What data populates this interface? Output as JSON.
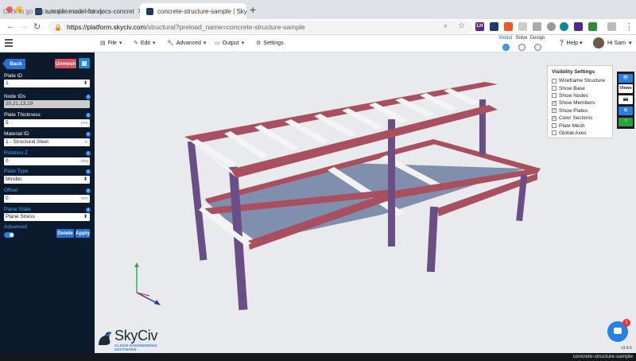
{
  "browser": {
    "hover_tip": "Click to go back, hold to see history",
    "tabs": [
      {
        "title": "sample-model-for-docs-concret",
        "active": false
      },
      {
        "title": "concrete-structure-sample | Sky",
        "active": true
      }
    ],
    "new_tab": "+",
    "url_host": "https://platform.skyciv.com",
    "url_path": "/structural?preload_name=concrete-structure-sample",
    "extensions": [
      "LH"
    ]
  },
  "header": {
    "menus": [
      {
        "label": "File",
        "icon": "file-icon"
      },
      {
        "label": "Edit",
        "icon": "pencil-icon"
      },
      {
        "label": "Advanced",
        "icon": "wrench-icon"
      },
      {
        "label": "Output",
        "icon": "monitor-icon"
      },
      {
        "label": "Settings",
        "icon": "gear-icon"
      }
    ],
    "steps": [
      "Model",
      "Solve",
      "Design"
    ],
    "help": "Help",
    "user": "Hi Sam"
  },
  "sidebar": {
    "back": "Back",
    "unmesh": "Unmesh",
    "plate_id_label": "Plate ID",
    "plate_id_value": "1",
    "node_ids_label": "Node IDs",
    "node_ids_value": "20,21,13,19",
    "thickness_label": "Plate Thickness",
    "thickness_value": "5",
    "thickness_unit": "mm",
    "material_label": "Material ID",
    "material_value": "1 - Structural Steel",
    "rotation_label": "Rotation Z",
    "rotation_value": "0",
    "rotation_unit": "deg",
    "plate_type_label": "Plate Type",
    "plate_type_value": "Mindlin",
    "offset_label": "Offset",
    "offset_value": "0",
    "offset_unit": "mm",
    "plane_state_label": "Plane State",
    "plane_state_value": "Plane Stress",
    "advanced_label": "Advanced",
    "advanced_on": true,
    "delete": "Delete",
    "apply": "Apply"
  },
  "visibility": {
    "title": "Visibility Settings",
    "items": [
      {
        "label": "Wireframe Structure",
        "checked": false
      },
      {
        "label": "Show Base",
        "checked": false
      },
      {
        "label": "Show Nodes",
        "checked": false
      },
      {
        "label": "Show Members",
        "checked": true
      },
      {
        "label": "Show Plates",
        "checked": true
      },
      {
        "label": "Color Sections",
        "checked": true
      },
      {
        "label": "Plate Mesh",
        "checked": false
      },
      {
        "label": "Global Axes",
        "checked": false
      }
    ]
  },
  "right_tools": {
    "views": "Views"
  },
  "brand": {
    "name": "SkyCiv",
    "tagline": "CLOUD ENGINEERING SOFTWARE"
  },
  "chat_badge": "1",
  "version": "v3.4.0",
  "footer_model": "concrete-structure-sample",
  "colors": {
    "sidebar": "#0b1a2c",
    "accent": "#2a6fd6",
    "unmesh": "#d9535f",
    "beam": "#a8505f",
    "column": "#6a4f86",
    "plate": "#6f7fa3"
  }
}
